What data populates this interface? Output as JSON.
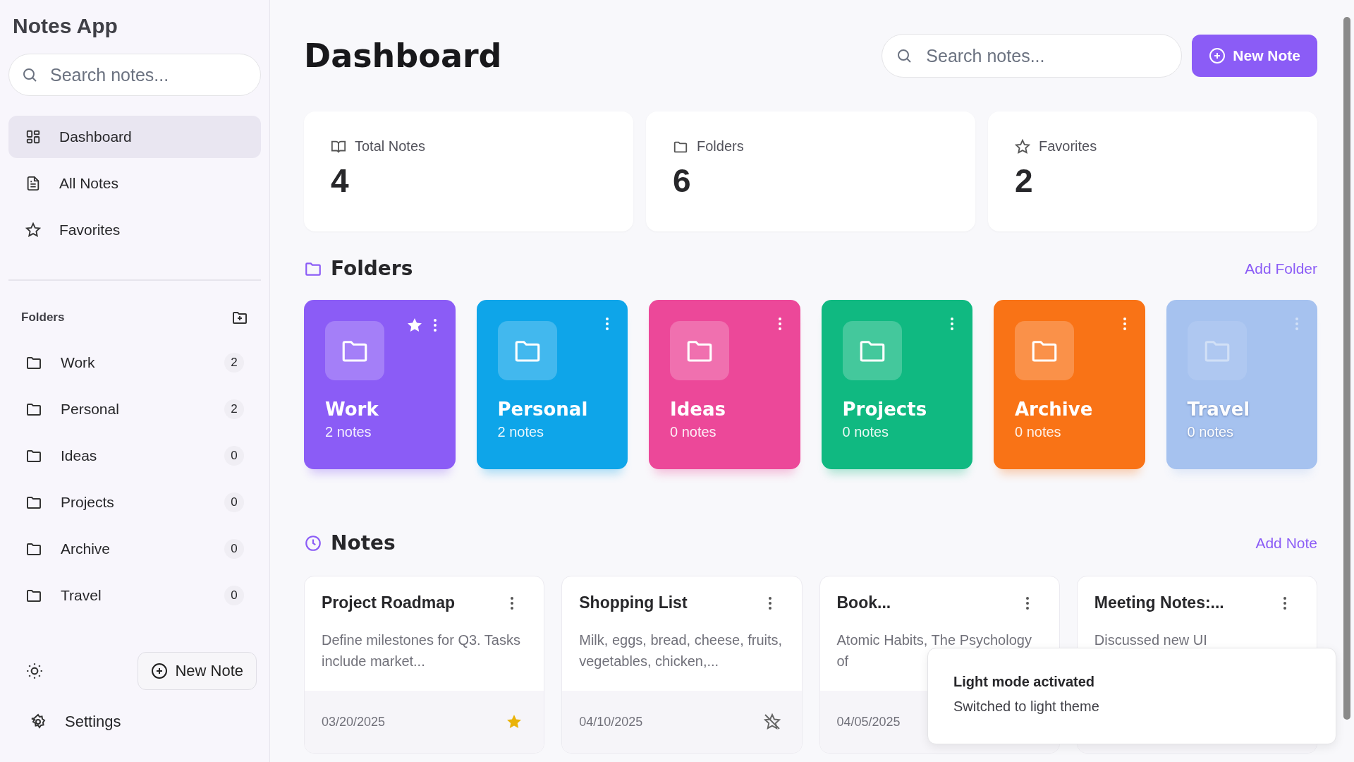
{
  "sidebar": {
    "title": "Notes App",
    "search": {
      "placeholder": "Search notes..."
    },
    "nav": [
      {
        "label": "Dashboard",
        "selected": true
      },
      {
        "label": "All Notes",
        "selected": false
      },
      {
        "label": "Favorites",
        "selected": false
      }
    ],
    "folders_heading": "Folders",
    "folders": [
      {
        "name": "Work",
        "count": "2"
      },
      {
        "name": "Personal",
        "count": "2"
      },
      {
        "name": "Ideas",
        "count": "0"
      },
      {
        "name": "Projects",
        "count": "0"
      },
      {
        "name": "Archive",
        "count": "0"
      },
      {
        "name": "Travel",
        "count": "0"
      }
    ],
    "new_note": "New Note",
    "settings": "Settings"
  },
  "header": {
    "title": "Dashboard",
    "search": {
      "placeholder": "Search notes..."
    },
    "new_note": "New Note"
  },
  "stats": [
    {
      "label": "Total Notes",
      "value": "4"
    },
    {
      "label": "Folders",
      "value": "6"
    },
    {
      "label": "Favorites",
      "value": "2"
    }
  ],
  "folders_section": {
    "title": "Folders",
    "action": "Add Folder",
    "cards": [
      {
        "name": "Work",
        "count": "2 notes",
        "color": "#8b5cf6",
        "favorite": true,
        "faded": false
      },
      {
        "name": "Personal",
        "count": "2 notes",
        "color": "#0ea5e9",
        "favorite": false,
        "faded": false
      },
      {
        "name": "Ideas",
        "count": "0 notes",
        "color": "#ec4899",
        "favorite": false,
        "faded": false
      },
      {
        "name": "Projects",
        "count": "0 notes",
        "color": "#10b981",
        "favorite": false,
        "faded": false
      },
      {
        "name": "Archive",
        "count": "0 notes",
        "color": "#f97316",
        "favorite": false,
        "faded": false
      },
      {
        "name": "Travel",
        "count": "0 notes",
        "color": "#98b9ee",
        "favorite": false,
        "faded": true
      }
    ]
  },
  "notes_section": {
    "title": "Notes",
    "action": "Add Note",
    "notes": [
      {
        "title": "Project Roadmap",
        "preview": "Define milestones for Q3. Tasks include market...",
        "date": "03/20/2025",
        "favorite": true
      },
      {
        "title": "Shopping List",
        "preview": "Milk, eggs, bread, cheese, fruits, vegetables, chicken,...",
        "date": "04/10/2025",
        "favorite": false
      },
      {
        "title": "Book...",
        "preview": "Atomic Habits, The Psychology of",
        "date": "04/05/2025"
      },
      {
        "title": "Meeting Notes:...",
        "preview": "Discussed new UI"
      }
    ]
  },
  "toast": {
    "title": "Light mode activated",
    "message": "Switched to light theme"
  }
}
